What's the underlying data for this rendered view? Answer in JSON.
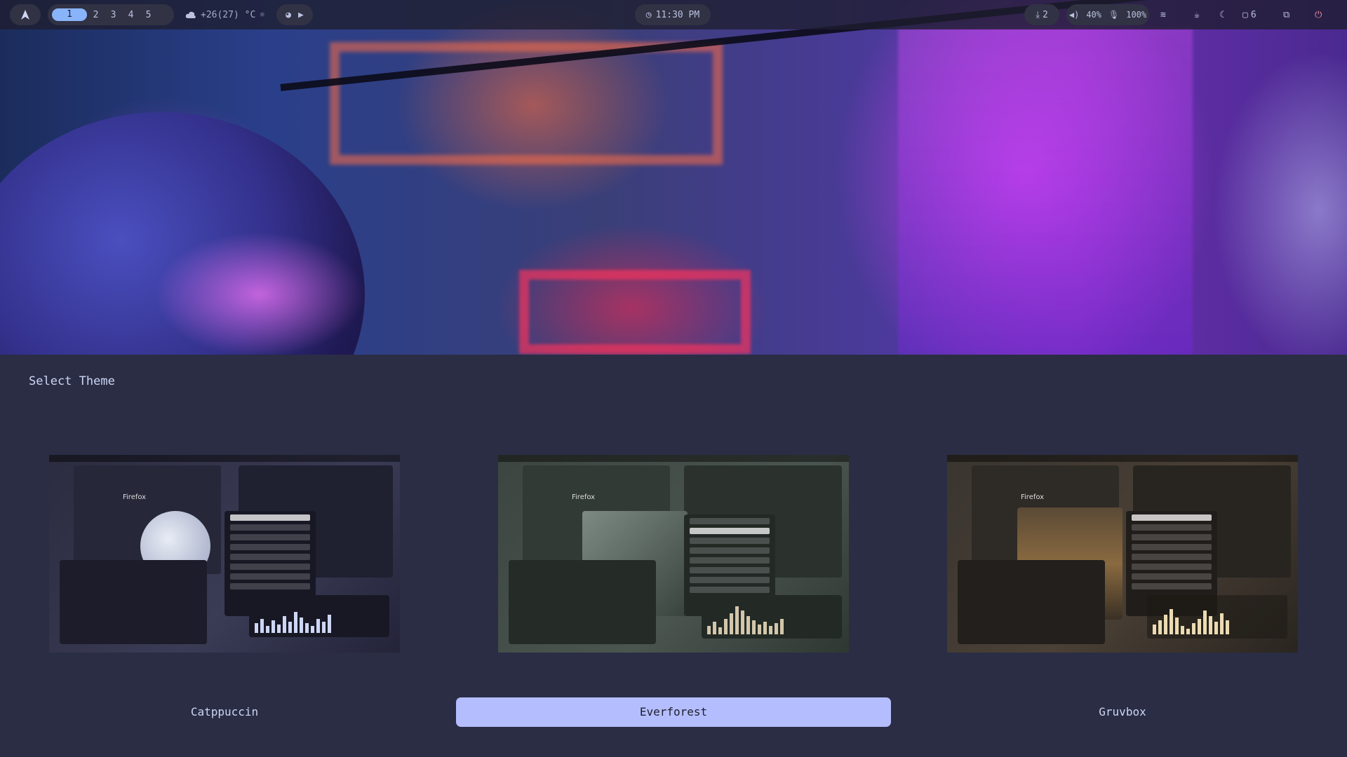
{
  "topbar": {
    "workspaces": [
      "1",
      "2",
      "3",
      "4",
      "5"
    ],
    "active_workspace": "1",
    "weather": "+26(27) °C",
    "clock": "11:30 PM",
    "downloads": "2",
    "volume": "40%",
    "mic": "100%",
    "clipboard_count": "6"
  },
  "theme_picker": {
    "title": "Select Theme",
    "themes": [
      {
        "name": "Catppuccin"
      },
      {
        "name": "Everforest",
        "selected": true
      },
      {
        "name": "Gruvbox"
      }
    ],
    "preview_app_label": "Firefox"
  },
  "colors": {
    "bar_bg": "#1e1e2e",
    "pill_bg": "#313244",
    "active_ws": "#89b4fa",
    "selected_label": "#b4befe",
    "power": "#f38ba8"
  }
}
